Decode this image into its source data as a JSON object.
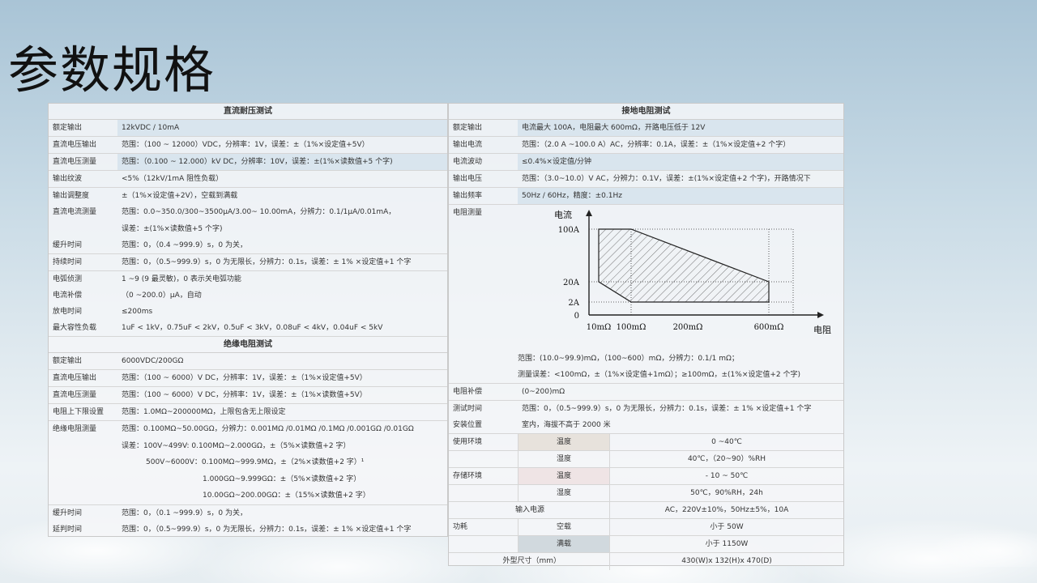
{
  "title": "参数规格",
  "dc_withstand": {
    "header": "直流耐压测试",
    "rows": [
      {
        "label": "额定输出",
        "value": "12kVDC / 10mA"
      },
      {
        "label": "直流电压输出",
        "value": "范围：（100 ~ 12000）VDC，分辨率：1V，误差：±（1%×设定值+5V）"
      },
      {
        "label": "直流电压测量",
        "value": "范围：（0.100 ~ 12.000）kV DC，分辨率：10V，误差：±(1%×读数值+5 个字)"
      },
      {
        "label": "输出纹波",
        "value": "<5%（12kV/1mA 阻性负载）"
      },
      {
        "label": "输出调整度",
        "value": "±（1%×设定值+2V），空载到满载"
      },
      {
        "label": "直流电流测量",
        "value": "范围：0.0~350.0/300~3500μA/3.00~ 10.00mA，分辨力：0.1/1μA/0.01mA，",
        "value2": "误差：±(1%×读数值+5 个字)"
      },
      {
        "label": "缓升时间",
        "value": "范围：0，（0.4 ~999.9）s，0 为关，"
      },
      {
        "label": "持续时间",
        "value": "范围：0，（0.5~999.9）s，0 为无限长，分辨力：0.1s，误差：± 1% ×设定值+1 个字"
      },
      {
        "label": "电弧侦测",
        "value": "1 ~9 (9 最灵敏)，0 表示关电弧功能"
      },
      {
        "label": "电流补偿",
        "value": "（0 ~200.0）μA，自动"
      },
      {
        "label": "放电时间",
        "value": "≤200ms"
      },
      {
        "label": "最大容性负载",
        "value": "1uF < 1kV，0.75uF < 2kV，0.5uF < 3kV，0.08uF < 4kV，0.04uF < 5kV"
      }
    ]
  },
  "insulation": {
    "header": "绝缘电阻测试",
    "rows": [
      {
        "label": "额定输出",
        "value": "6000VDC/200GΩ"
      },
      {
        "label": "直流电压输出",
        "value": "范围：（100 ~ 6000）V DC，分辨率：1V，误差：±（1%×设定值+5V）"
      },
      {
        "label": "直流电压测量",
        "value": "范围：（100 ~ 6000）V DC，分辨率：1V，误差：±（1%×读数值+5V）"
      },
      {
        "label": "电阻上下限设置",
        "value": "范围：1.0MΩ~200000MΩ，上限包含无上限设定"
      }
    ],
    "measure_label": "绝缘电阻测量",
    "measure_lines": [
      "范围：0.100MΩ~50.00GΩ，分辨力：0.001MΩ /0.01MΩ /0.1MΩ /0.001GΩ /0.01GΩ",
      "误差：100V~499V:    0.100MΩ~2.000GΩ，±（5%×读数值+2 字）",
      "500V~6000V：0.100MΩ~999.9MΩ，±（2%×读数值+2 字）¹",
      "1.000GΩ~9.999GΩ：±（5%×读数值+2 字）",
      "10.00GΩ~200.00GΩ：±（15%×读数值+2 字）"
    ],
    "rows_after": [
      {
        "label": "缓升时间",
        "value": "范围：0，（0.1 ~999.9）s，0 为关，"
      },
      {
        "label": "延判时间",
        "value": "范围：0，（0.5~999.9）s，0 为无限长，分辨力：0.1s，误差：± 1% ×设定值+1 个字"
      }
    ]
  },
  "ground": {
    "header": "接地电阻测试",
    "rows": [
      {
        "label": "额定输出",
        "value": "电流最大 100A，电阻最大 600mΩ，开路电压低于 12V"
      },
      {
        "label": "输出电流",
        "value": "范围：（2.0 A ~100.0 A）AC，分辨率：0.1A，误差：±（1%×设定值+2 个字）"
      },
      {
        "label": "电流波动",
        "value": "≤0.4%×设定值/分钟"
      },
      {
        "label": "输出电压",
        "value": "范围：（3.0~10.0）V AC，分辨力：0.1V，误差：±(1%×设定值+2 个字)，开路情况下"
      },
      {
        "label": "输出频率",
        "value": "50Hz / 60Hz，精度：±0.1Hz"
      }
    ],
    "measure_label": "电阻测量",
    "measure_notes": [
      "范围：(10.0~99.9)mΩ，（100~600）mΩ，分辨力：0.1/1 mΩ；",
      "测量误差：<100mΩ，±（1%×设定值+1mΩ）；≥100mΩ，±(1%×设定值+2 个字)"
    ],
    "rows_after": [
      {
        "label": "电阻补偿",
        "value": "(0~200)mΩ"
      },
      {
        "label": "测试时间",
        "value": "范围：0，（0.5~999.9）s，0 为无限长，分辨力：0.1s，误差：± 1% ×设定值+1 个字"
      },
      {
        "label": "安装位置",
        "value": "室内，海拔不高于 2000 米"
      }
    ],
    "env_use_label": "使用环境",
    "env_store_label": "存储环境",
    "env_rows": [
      {
        "b": "温度",
        "c": "0 ~40℃"
      },
      {
        "b": "湿度",
        "c": "40℃，（20~90）%RH"
      },
      {
        "b": "温度",
        "c": "- 10 ~ 50℃"
      },
      {
        "b": "湿度",
        "c": "50℃，90%RH，24h"
      }
    ],
    "input_power_label": "输入电源",
    "input_power_value": "AC，220V±10%，50Hz±5%，10A",
    "power_label": "功耗",
    "power_rows": [
      {
        "b": "空载",
        "c": "小于 50W"
      },
      {
        "b": "满载",
        "c": "小于 1150W"
      }
    ],
    "dimension_label": "外型尺寸（mm）",
    "dimension_value": "430(W)x 132(H)x 470(D)"
  },
  "chart_data": {
    "type": "area",
    "title": "",
    "ylabel": "电流",
    "xlabel": "电阻",
    "y_ticks": [
      "100A",
      "20A",
      "2A",
      "0"
    ],
    "x_ticks": [
      "10mΩ",
      "100mΩ",
      "200mΩ",
      "600mΩ"
    ],
    "region": [
      {
        "x": "10mΩ",
        "y": "100A"
      },
      {
        "x": "100mΩ",
        "y": "100A"
      },
      {
        "x": "600mΩ",
        "y": "20A"
      },
      {
        "x": "600mΩ",
        "y": "2A"
      },
      {
        "x": "100mΩ",
        "y": "2A"
      },
      {
        "x": "10mΩ",
        "y": "20A"
      }
    ]
  }
}
